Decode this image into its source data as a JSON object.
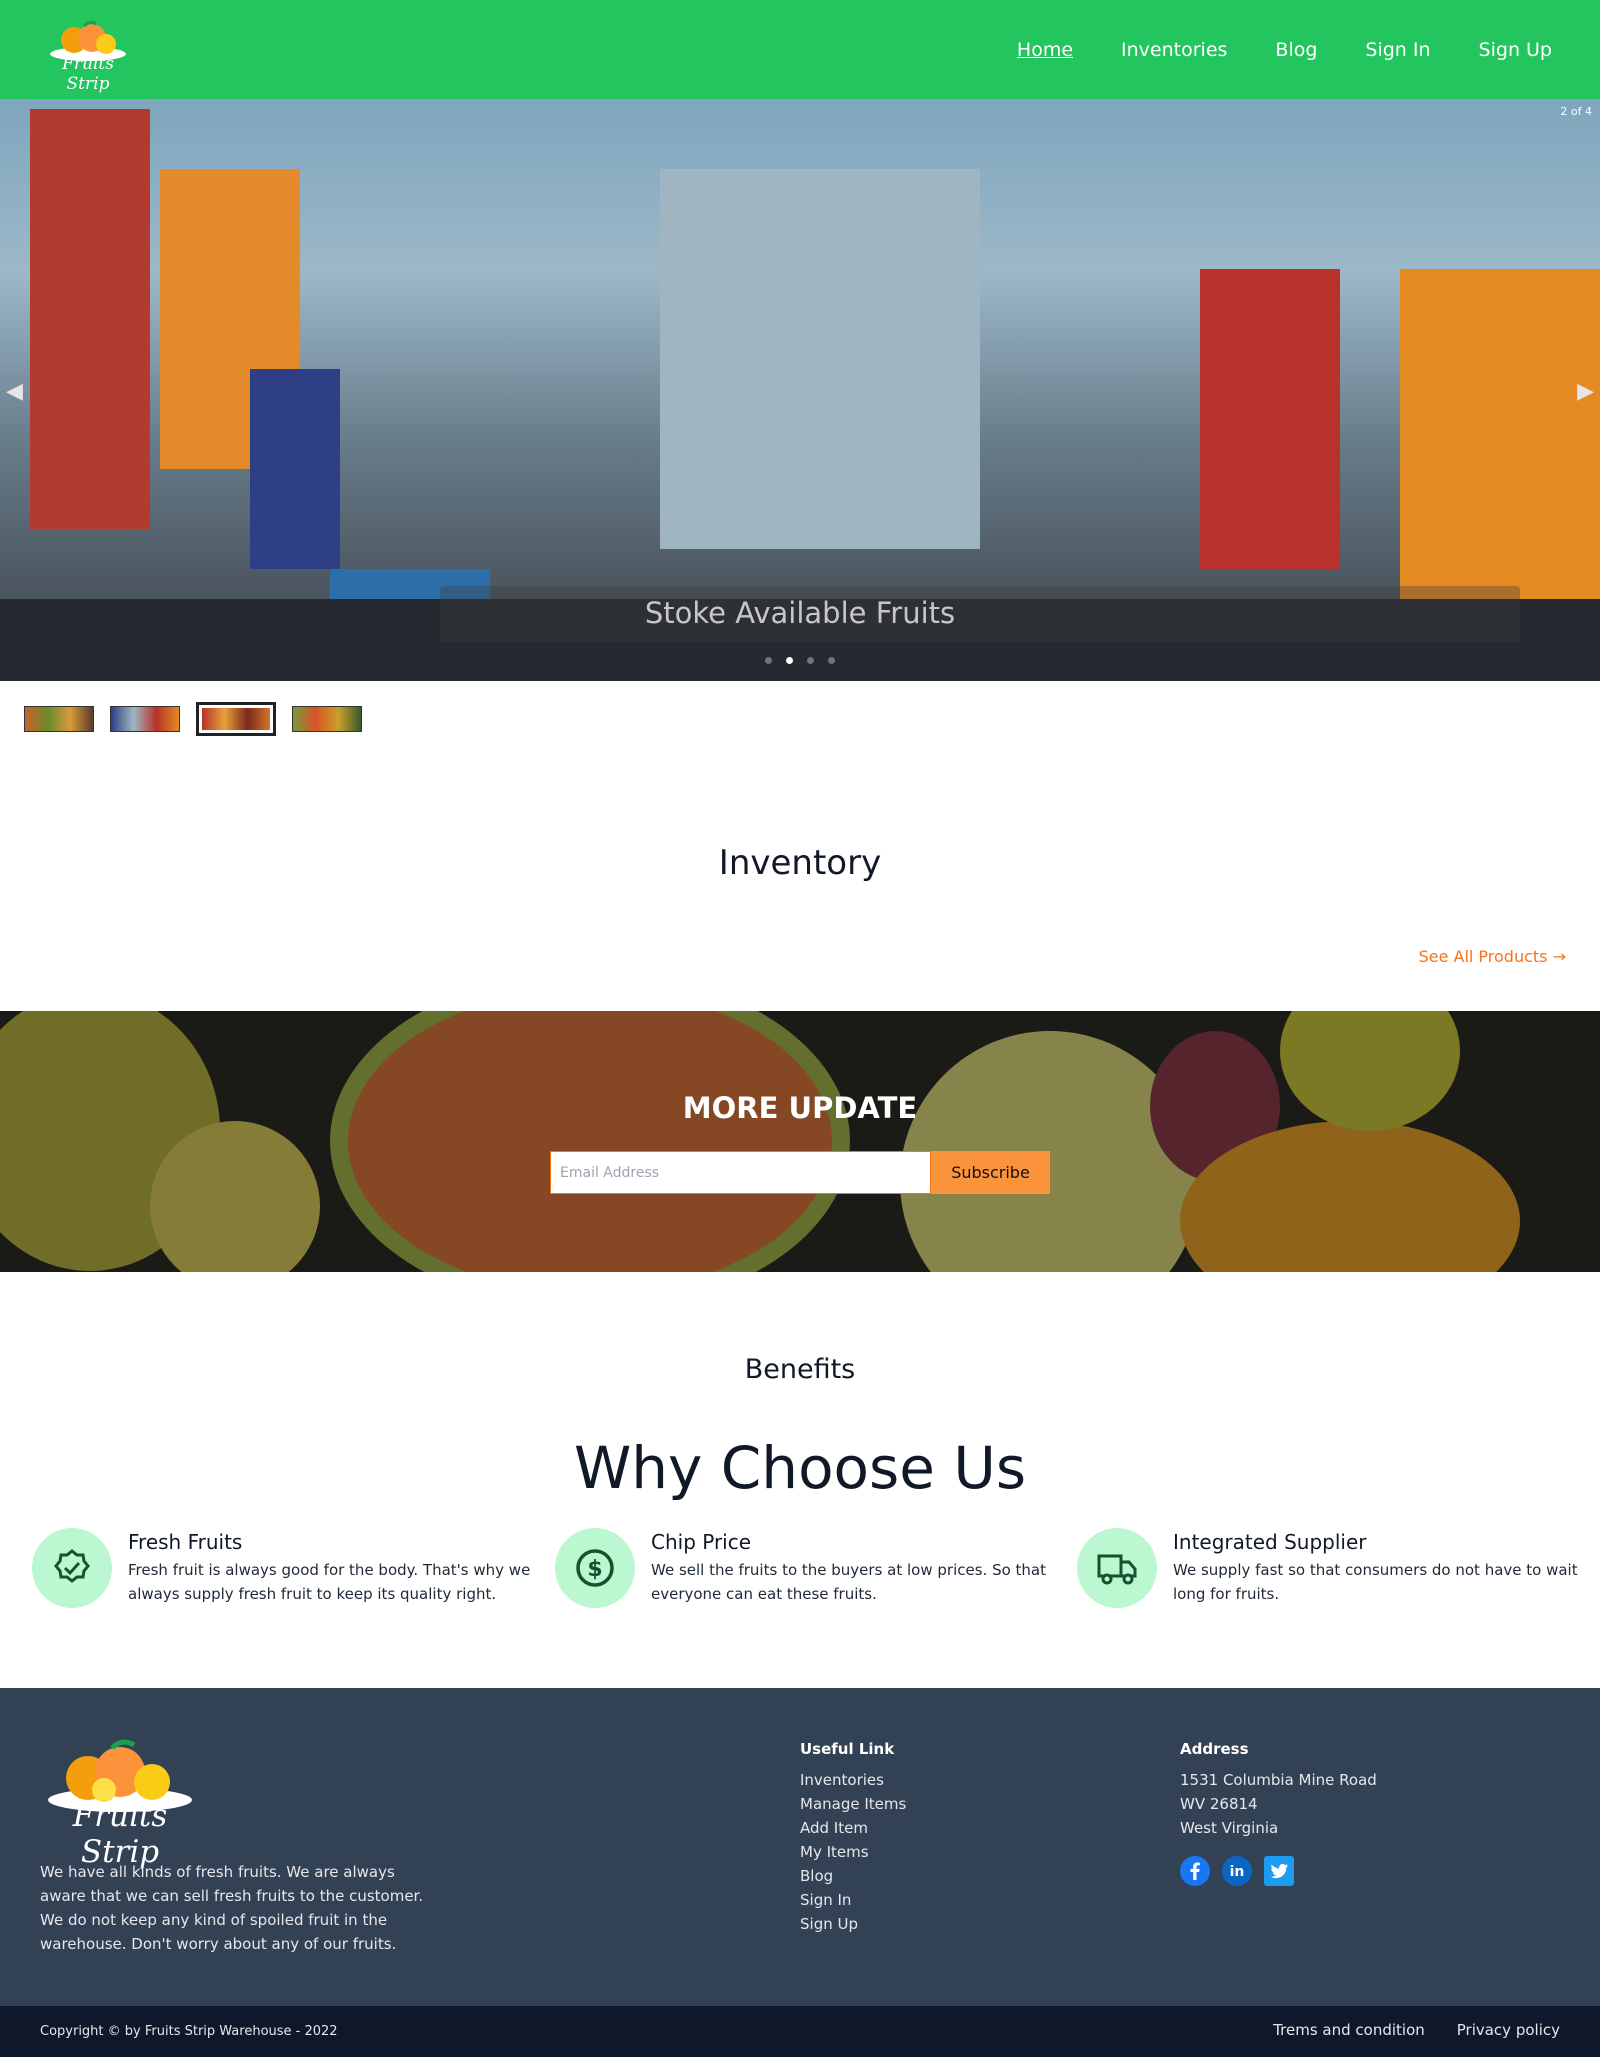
{
  "brand": {
    "logo_text": "Fruits Strip"
  },
  "nav": {
    "items": [
      {
        "label": "Home",
        "active": true
      },
      {
        "label": "Inventories"
      },
      {
        "label": "Blog"
      },
      {
        "label": "Sign In"
      },
      {
        "label": "Sign Up"
      }
    ]
  },
  "hero": {
    "counter": "2 of 4",
    "caption": "Stoke Available Fruits",
    "slide_count": 4,
    "active_slide": 2,
    "prev_icon": "chevron-left-icon",
    "next_icon": "chevron-right-icon"
  },
  "thumbnails": {
    "count": 4,
    "active_index": 3
  },
  "inventory": {
    "title": "Inventory",
    "see_all": "See All Products →"
  },
  "newsletter": {
    "heading": "MORE UPDATE",
    "placeholder": "Email Address",
    "button": "Subscribe"
  },
  "benefits": {
    "eyebrow": "Benefits",
    "title": "Why Choose Us",
    "items": [
      {
        "icon": "badge-check-icon",
        "title": "Fresh Fruits",
        "desc": "Fresh fruit is always good for the body. That's why we always supply fresh fruit to keep its quality right."
      },
      {
        "icon": "dollar-circle-icon",
        "title": "Chip Price",
        "desc": "We sell the fruits to the buyers at low prices. So that everyone can eat these fruits."
      },
      {
        "icon": "truck-icon",
        "title": "Integrated Supplier",
        "desc": "We supply fast so that consumers do not have to wait long for fruits."
      }
    ]
  },
  "footer": {
    "about": "We have all kinds of fresh fruits. We are always aware that we can sell fresh fruits to the customer. We do not keep any kind of spoiled fruit in the warehouse. Don't worry about any of our fruits.",
    "useful_title": "Useful Link",
    "links": [
      "Inventories",
      "Manage Items",
      "Add Item",
      "My Items",
      "Blog",
      "Sign In",
      "Sign Up"
    ],
    "address_title": "Address",
    "address": [
      "1531 Columbia Mine Road",
      "WV 26814",
      "West Virginia"
    ],
    "socials": [
      "facebook-icon",
      "linkedin-icon",
      "twitter-icon"
    ],
    "copyright": "Copyright © by Fruits Strip Warehouse - 2022",
    "legal": [
      "Trems and condition",
      "Privacy policy"
    ]
  },
  "colors": {
    "header": "#22c55e",
    "accent": "#f97316",
    "footer": "#334155",
    "bottom_bar": "#0f172a",
    "icon_circle": "#bbf7d0"
  }
}
